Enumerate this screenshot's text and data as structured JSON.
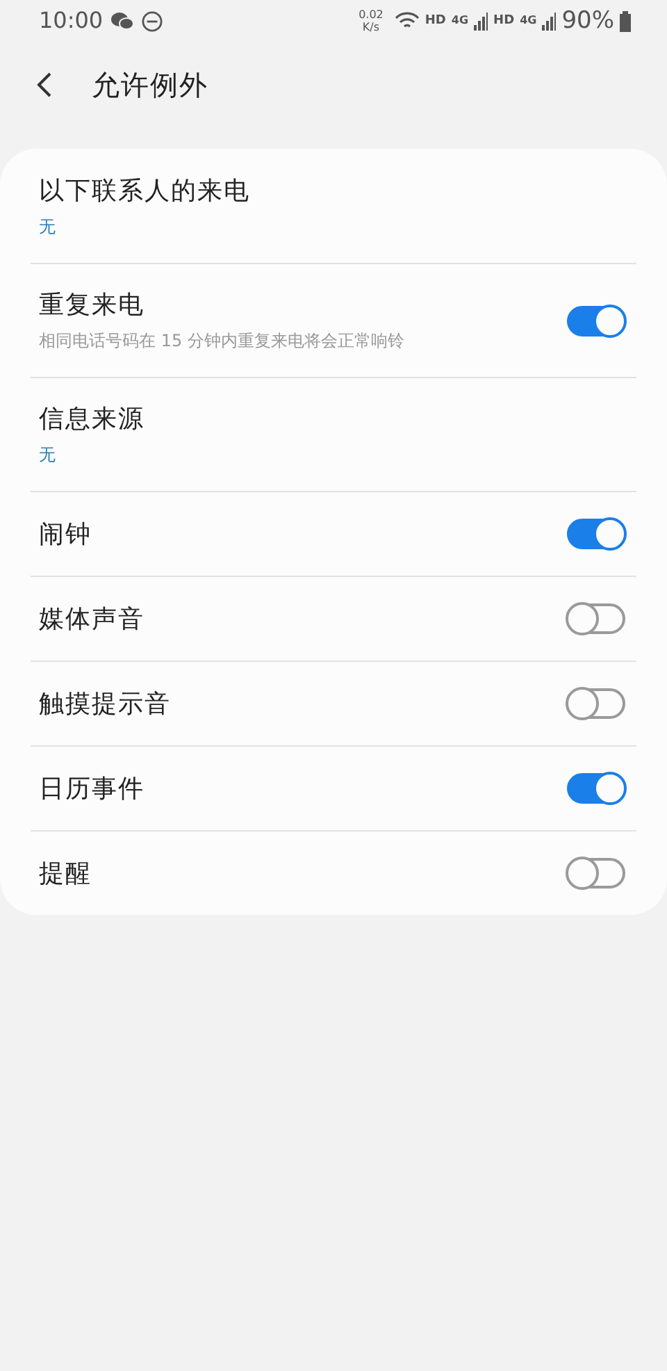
{
  "status_bar": {
    "time": "10:00",
    "speed_value": "0.02",
    "speed_unit": "K/s",
    "sims": [
      {
        "hd": "HD",
        "network": "4G"
      },
      {
        "hd": "HD",
        "network": "4G"
      }
    ],
    "battery": "90%"
  },
  "header": {
    "title": "允许例外"
  },
  "settings": [
    {
      "kind": "link",
      "title": "以下联系人的来电",
      "value": "无"
    },
    {
      "kind": "toggle",
      "title": "重复来电",
      "subtitle": "相同电话号码在 15 分钟内重复来电将会正常响铃",
      "on": true
    },
    {
      "kind": "link",
      "title": "信息来源",
      "value": "无"
    },
    {
      "kind": "toggle",
      "title": "闹钟",
      "on": true
    },
    {
      "kind": "toggle",
      "title": "媒体声音",
      "on": false
    },
    {
      "kind": "toggle",
      "title": "触摸提示音",
      "on": false
    },
    {
      "kind": "toggle",
      "title": "日历事件",
      "on": true
    },
    {
      "kind": "toggle",
      "title": "提醒",
      "on": false
    }
  ]
}
